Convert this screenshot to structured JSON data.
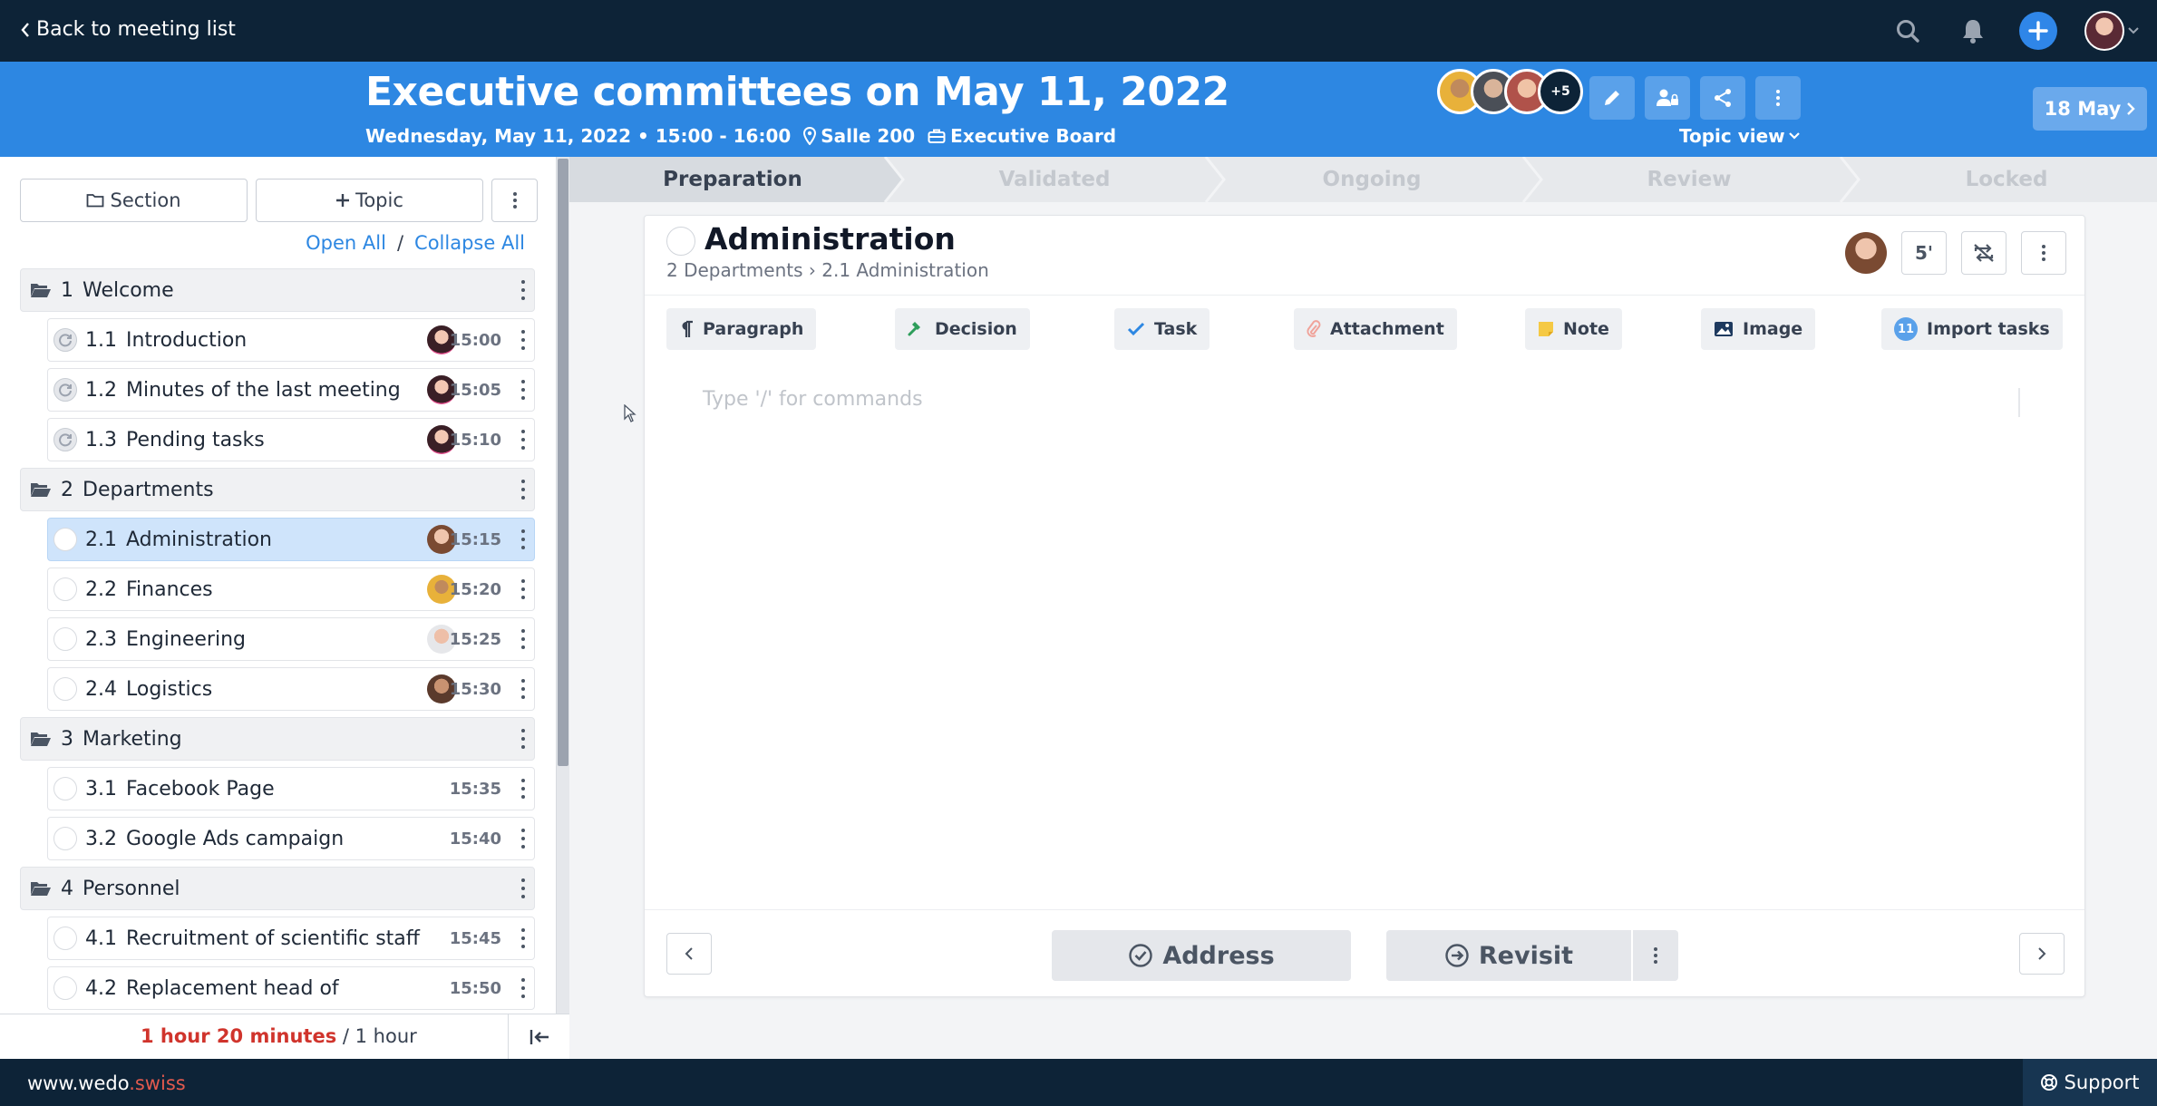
{
  "topbar": {
    "back_label": "Back to meeting list"
  },
  "header": {
    "title": "Executive committees on May 11, 2022",
    "date_time": "Wednesday, May 11, 2022 • 15:00 - 16:00",
    "location": "Salle 200",
    "board": "Executive Board",
    "participants_more": "+5",
    "view_label": "Topic view",
    "next_date": "18 May"
  },
  "sidebar": {
    "section_button": "Section",
    "topic_button": "Topic",
    "open_all": "Open All",
    "separator": "/",
    "collapse_all": "Collapse All",
    "sections": [
      {
        "num": "1",
        "title": "Welcome",
        "topics": [
          {
            "num": "1.1",
            "title": "Introduction",
            "time": "15:00"
          },
          {
            "num": "1.2",
            "title": "Minutes of the last meeting",
            "time": "15:05"
          },
          {
            "num": "1.3",
            "title": "Pending tasks",
            "time": "15:10"
          }
        ]
      },
      {
        "num": "2",
        "title": "Departments",
        "topics": [
          {
            "num": "2.1",
            "title": "Administration",
            "time": "15:15"
          },
          {
            "num": "2.2",
            "title": "Finances",
            "time": "15:20"
          },
          {
            "num": "2.3",
            "title": "Engineering",
            "time": "15:25"
          },
          {
            "num": "2.4",
            "title": "Logistics",
            "time": "15:30"
          }
        ]
      },
      {
        "num": "3",
        "title": "Marketing",
        "topics": [
          {
            "num": "3.1",
            "title": "Facebook Page",
            "time": "15:35"
          },
          {
            "num": "3.2",
            "title": "Google Ads campaign",
            "time": "15:40"
          }
        ]
      },
      {
        "num": "4",
        "title": "Personnel",
        "topics": [
          {
            "num": "4.1",
            "title": "Recruitment of scientific staff",
            "time": "15:45"
          },
          {
            "num": "4.2",
            "title": "Replacement head of",
            "time": "15:50"
          }
        ]
      }
    ],
    "duration_actual": "1 hour 20 minutes",
    "duration_planned": " / 1 hour"
  },
  "stepper": {
    "steps": [
      "Preparation",
      "Validated",
      "Ongoing",
      "Review",
      "Locked"
    ],
    "current": "Preparation"
  },
  "topic": {
    "title": "Administration",
    "breadcrumb": "2 Departments › 2.1 Administration",
    "duration": "5'",
    "blocks": [
      "Paragraph",
      "Decision",
      "Task",
      "Attachment",
      "Note",
      "Image",
      "Import tasks"
    ],
    "import_badge": "11",
    "editor_placeholder": "Type '/' for commands",
    "address_label": "Address",
    "revisit_label": "Revisit"
  },
  "footer": {
    "site_prefix": "www.wedo",
    "site_suffix": ".swiss",
    "support": "Support"
  },
  "colors": {
    "topbar": "#0d2337",
    "header": "#2d87e2",
    "active_topic": "#cfe4fb",
    "over_time": "#d0342c"
  }
}
